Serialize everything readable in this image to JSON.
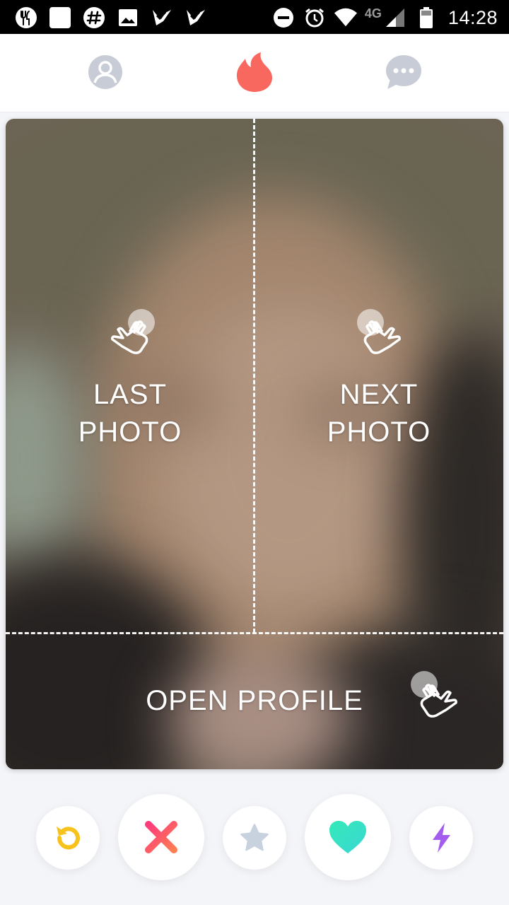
{
  "status_bar": {
    "time": "14:28",
    "network": "4G",
    "left_icons": [
      "restaurant-icon",
      "blank-notification-icon",
      "slack-icon",
      "image-icon",
      "check-shield-icon",
      "check-shield-icon"
    ],
    "right_icons": [
      "do-not-disturb-icon",
      "alarm-icon",
      "wifi-icon",
      "signal-icon",
      "battery-icon"
    ]
  },
  "top_nav": {
    "items": [
      "profile-icon",
      "flame-icon",
      "chat-icon"
    ],
    "active": "flame-icon",
    "active_color": "#f8685f",
    "inactive_color": "#c7ccd6"
  },
  "card": {
    "hints": {
      "last_photo": "LAST\nPHOTO",
      "next_photo": "NEXT\nPHOTO",
      "open_profile": "OPEN PROFILE"
    }
  },
  "actions": {
    "buttons": [
      {
        "name": "rewind-button",
        "icon": "rewind-icon",
        "color": "#f7c21b"
      },
      {
        "name": "nope-button",
        "icon": "x-icon",
        "color": "#fd5a68"
      },
      {
        "name": "super-like-button",
        "icon": "star-icon",
        "color": "#c8d2df"
      },
      {
        "name": "like-button",
        "icon": "heart-icon",
        "color": "#3ae0c2"
      },
      {
        "name": "boost-button",
        "icon": "lightning-icon",
        "color": "#a45cef"
      }
    ]
  }
}
